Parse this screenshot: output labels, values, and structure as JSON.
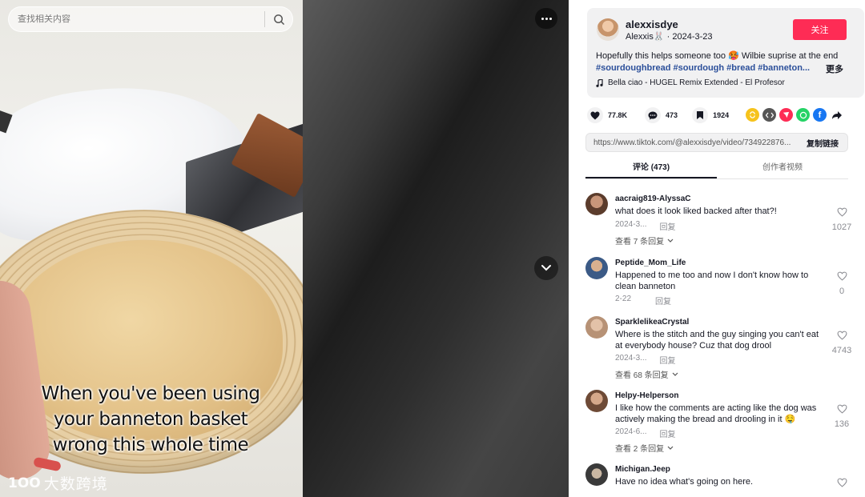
{
  "search": {
    "placeholder": "查找相关内容",
    "icon": "search-icon"
  },
  "video": {
    "caption": "When you've been using\nyour banneton basket\nwrong this whole time"
  },
  "watermark": {
    "logo": "1OO",
    "text": "大数跨境"
  },
  "post": {
    "username": "alexxisdye",
    "nickname": "Alexxis🐰",
    "date": "2024-3-23",
    "follow_label": "关注",
    "description": "Hopefully this helps someone too 🥵 Wilbie suprise at the end",
    "hashtags": "#sourdoughbread #sourdough #bread #banneton...",
    "more_label": "更多",
    "music": "Bella ciao - HUGEL Remix Extended - El Profesor"
  },
  "actions": {
    "likes": "77.8K",
    "comments": "473",
    "saves": "1924"
  },
  "share_icons": [
    "repost-icon",
    "embed-icon",
    "send-icon",
    "whatsapp-icon",
    "facebook-icon",
    "share-arrow-icon"
  ],
  "link": {
    "url": "https://www.tiktok.com/@alexxisdye/video/734922876...",
    "copy_label": "复制链接"
  },
  "tabs": [
    {
      "label": "评论 (473)",
      "active": true
    },
    {
      "label": "创作者视频",
      "active": false
    }
  ],
  "comments": [
    {
      "user": "aacraig819-AlyssaC",
      "text": "what does it look liked backed after that?!",
      "date": "2024-3...",
      "reply_label": "回复",
      "likes": "1027",
      "replies": "查看 7 条回复"
    },
    {
      "user": "Peptide_Mom_Life",
      "text": "Happened to me too and now I don't know how to clean banneton",
      "date": "2-22",
      "reply_label": "回复",
      "likes": "0",
      "replies": ""
    },
    {
      "user": "SparklelikeaCrystal",
      "text": "Where is the stitch and the guy singing you can't eat at everybody house? Cuz that dog drool",
      "date": "2024-3...",
      "reply_label": "回复",
      "likes": "4743",
      "replies": "查看 68 条回复"
    },
    {
      "user": "Helpy-Helperson",
      "text": "I like how the comments are acting like the dog was actively making the bread and drooling in it 🤤",
      "date": "2024-6...",
      "reply_label": "回复",
      "likes": "136",
      "replies": "查看 2 条回复"
    },
    {
      "user": "Michigan.Jeep",
      "text": "Have no idea what's going on here.",
      "date": "",
      "reply_label": "",
      "likes": "",
      "replies": ""
    }
  ],
  "colors": {
    "accent": "#fe2c55",
    "hashtag": "#2b4f9a",
    "panel_bg": "#ffffff",
    "card_bg": "#f1f1f2"
  }
}
